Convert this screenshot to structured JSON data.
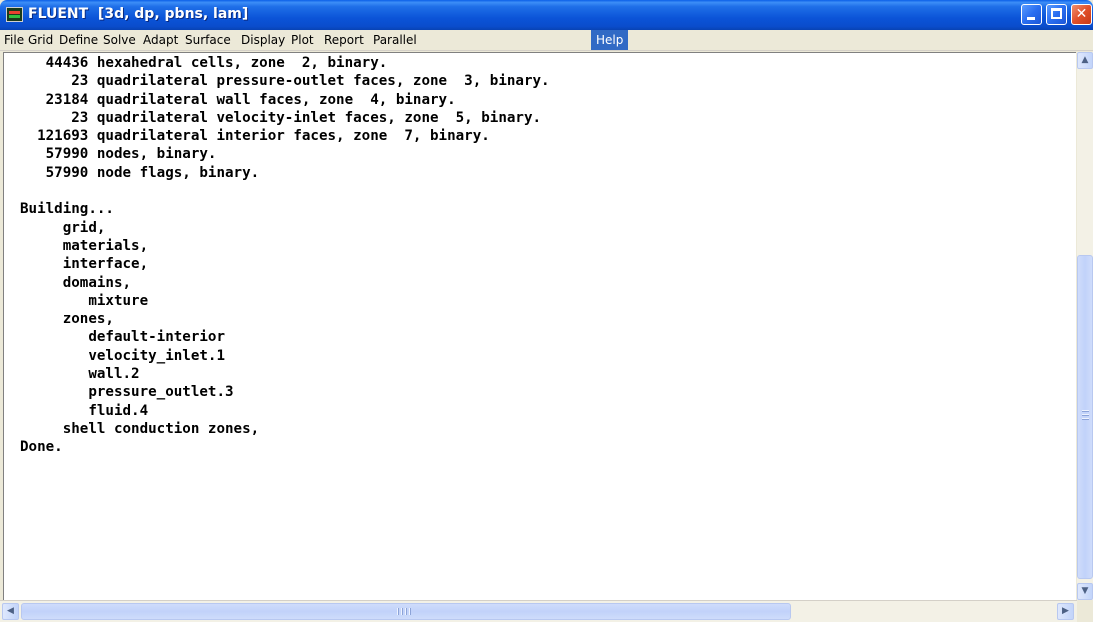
{
  "window": {
    "title": "FLUENT  [3d, dp, pbns, lam]",
    "icon": "fluent-app-icon",
    "controls": {
      "minimize": "minimize-icon",
      "maximize": "maximize-icon",
      "close": "close-icon",
      "close_glyph": "✕"
    }
  },
  "menu": {
    "items": [
      {
        "label": "File"
      },
      {
        "label": "Grid"
      },
      {
        "label": "Define"
      },
      {
        "label": "Solve"
      },
      {
        "label": "Adapt"
      },
      {
        "label": "Surface"
      },
      {
        "label": "Display"
      },
      {
        "label": "Plot"
      },
      {
        "label": "Report"
      },
      {
        "label": "Parallel"
      },
      {
        "label": "Help",
        "active": true
      }
    ]
  },
  "console": {
    "lines": [
      "   44436 hexahedral cells, zone  2, binary.",
      "      23 quadrilateral pressure-outlet faces, zone  3, binary.",
      "   23184 quadrilateral wall faces, zone  4, binary.",
      "      23 quadrilateral velocity-inlet faces, zone  5, binary.",
      "  121693 quadrilateral interior faces, zone  7, binary.",
      "   57990 nodes, binary.",
      "   57990 node flags, binary.",
      "",
      "Building...",
      "     grid,",
      "     materials,",
      "     interface,",
      "     domains,",
      "        mixture",
      "     zones,",
      "        default-interior",
      "        velocity_inlet.1",
      "        wall.2",
      "        pressure_outlet.3",
      "        fluid.4",
      "     shell conduction zones,",
      "Done."
    ]
  },
  "scrollbars": {
    "up_arrow": "▲",
    "down_arrow": "▼",
    "left_arrow": "◀",
    "right_arrow": "▶"
  }
}
